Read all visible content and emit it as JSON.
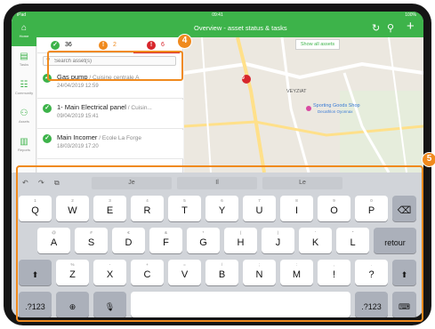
{
  "status_bar": {
    "left": "iPad",
    "time": "09:41",
    "right": "100%"
  },
  "nav": {
    "title": "Overview - asset status & tasks",
    "icons": [
      "refresh-icon",
      "search-icon",
      "add-icon"
    ],
    "refresh_glyph": "↻",
    "search_glyph": "⚲",
    "add_glyph": "+"
  },
  "rail": [
    {
      "label": "Home",
      "icon": "home-icon",
      "glyph": "⌂"
    },
    {
      "label": "Tasks",
      "icon": "tasks-icon",
      "glyph": "▤"
    },
    {
      "label": "Community",
      "icon": "community-icon",
      "glyph": "☷"
    },
    {
      "label": "Assets",
      "icon": "assets-icon",
      "glyph": "⚇"
    },
    {
      "label": "Reports",
      "icon": "reports-icon",
      "glyph": "▥"
    }
  ],
  "filters": [
    {
      "count": "36",
      "color": "#3db34a",
      "glyph": "✓",
      "icon": "check-icon"
    },
    {
      "count": "2",
      "color": "#f08a1e",
      "glyph": "!",
      "icon": "warning-icon"
    },
    {
      "count": "6",
      "color": "#d7262c",
      "glyph": "!",
      "icon": "alert-icon"
    }
  ],
  "search": {
    "placeholder": "Search asset(s)"
  },
  "assets": [
    {
      "name": "Gas pump",
      "location": " / Cuisine centrale A",
      "date": "24/04/2019 12:59"
    },
    {
      "name": "1- Main Electrical panel",
      "location": " / Cuisin...",
      "date": "09/04/2019 15:41"
    },
    {
      "name": "Main Incomer",
      "location": " / Ecole La Forge",
      "date": "18/03/2019 17:20"
    }
  ],
  "map": {
    "show_all": "Show all assets",
    "labels": [
      "VEYZIAT",
      "Sporting Goods Shop",
      "Decathlon Oyonnax"
    ],
    "marker_count": "9"
  },
  "badges": {
    "top": "4",
    "right": "5"
  },
  "keyboard": {
    "suggestions": [
      "Je",
      "Il",
      "Le"
    ],
    "toolbar": {
      "undo": "↶",
      "redo": "↷",
      "paste": "⧉"
    },
    "row1": [
      {
        "pri": "Q",
        "sec": "1"
      },
      {
        "pri": "W",
        "sec": "2"
      },
      {
        "pri": "E",
        "sec": "3"
      },
      {
        "pri": "R",
        "sec": "4"
      },
      {
        "pri": "T",
        "sec": "5"
      },
      {
        "pri": "Y",
        "sec": "6"
      },
      {
        "pri": "U",
        "sec": "7"
      },
      {
        "pri": "I",
        "sec": "8"
      },
      {
        "pri": "O",
        "sec": "9"
      },
      {
        "pri": "P",
        "sec": "0"
      }
    ],
    "row2": [
      {
        "pri": "A",
        "sec": "@"
      },
      {
        "pri": "S",
        "sec": "#"
      },
      {
        "pri": "D",
        "sec": "€"
      },
      {
        "pri": "F",
        "sec": "&"
      },
      {
        "pri": "G",
        "sec": "*"
      },
      {
        "pri": "H",
        "sec": "("
      },
      {
        "pri": "J",
        "sec": ")"
      },
      {
        "pri": "K",
        "sec": "'"
      },
      {
        "pri": "L",
        "sec": "\""
      }
    ],
    "row3": [
      {
        "pri": "Z",
        "sec": "%"
      },
      {
        "pri": "X",
        "sec": "-"
      },
      {
        "pri": "C",
        "sec": "+"
      },
      {
        "pri": "V",
        "sec": "="
      },
      {
        "pri": "B",
        "sec": "/"
      },
      {
        "pri": "N",
        "sec": ";"
      },
      {
        "pri": "M",
        "sec": ":"
      },
      {
        "pri": "!",
        "sec": ","
      },
      {
        "pri": "?",
        "sec": "."
      }
    ],
    "backspace": "⌫",
    "return": "retour",
    "shift": "⬆",
    "numbers": ".?123",
    "globe": "⊕",
    "mic": "🎙",
    "hide": "⌨"
  },
  "colors": {
    "brand_green": "#3db34a",
    "highlight_orange": "#f08a1e",
    "alert_red": "#d7262c"
  }
}
